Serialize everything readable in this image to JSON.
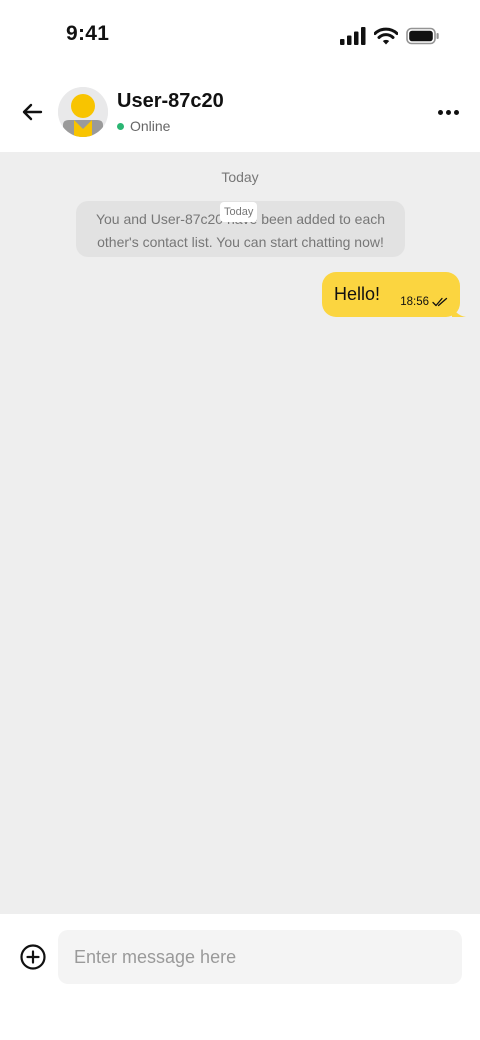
{
  "status_bar": {
    "time": "9:41",
    "icons": [
      "cellular-signal-icon",
      "wifi-icon",
      "battery-icon"
    ]
  },
  "header": {
    "contact_name": "User-87c20",
    "presence": "Online",
    "presence_color": "#2bb673",
    "avatar_icon": "user-avatar-icon",
    "back_icon": "arrow-left-icon",
    "more_icon": "more-horizontal-icon"
  },
  "conversation": {
    "date_separator": "Today",
    "sticky_date": "Today",
    "system_notice": "You and User-87c20 have been added to each other's contact list. You can start chatting now!",
    "messages": [
      {
        "direction": "outgoing",
        "text": "Hello!",
        "time": "18:56",
        "status_icon": "double-check-icon"
      }
    ]
  },
  "composer": {
    "placeholder": "Enter message here",
    "value": "",
    "attach_icon": "plus-circle-icon"
  },
  "colors": {
    "accent": "#fbd540",
    "messages_background": "#eeeeee",
    "online": "#2bb673"
  }
}
